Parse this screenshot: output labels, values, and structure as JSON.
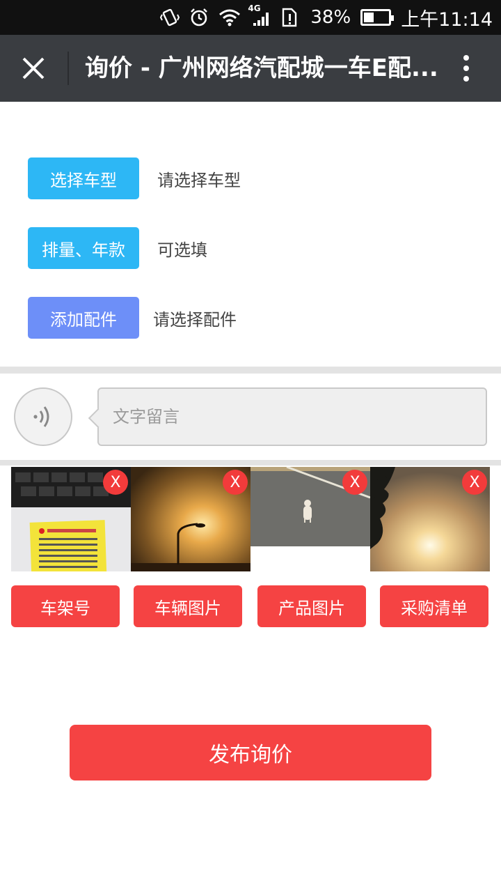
{
  "status_bar": {
    "network": "4G",
    "battery_percent": "38%",
    "time": "上午11:14",
    "icons": [
      "vibrate-icon",
      "alarm-icon",
      "wifi-icon",
      "signal-icon",
      "sim-alert-icon",
      "battery-icon"
    ]
  },
  "app_bar": {
    "title": "询价 - 广州网络汽配城一车E配..."
  },
  "form": {
    "select_model": {
      "button": "选择车型",
      "hint": "请选择车型"
    },
    "displacement": {
      "button": "排量、年款",
      "hint": "可选填"
    },
    "add_parts": {
      "button": "添加配件",
      "hint": "请选择配件"
    }
  },
  "message": {
    "placeholder": "文字留言",
    "value": ""
  },
  "thumbnails": {
    "remove_label": "X",
    "items": [
      "vin-photo",
      "streetlamp-sunset-photo",
      "dog-road-photo",
      "sunset-tree-photo"
    ]
  },
  "upload_buttons": [
    "车架号",
    "车辆图片",
    "产品图片",
    "采购清单"
  ],
  "publish_label": "发布询价",
  "colors": {
    "app_bar": "#3a3d41",
    "blue": "#2db7f5",
    "purple": "#6d8ff8",
    "red": "#f54343"
  }
}
